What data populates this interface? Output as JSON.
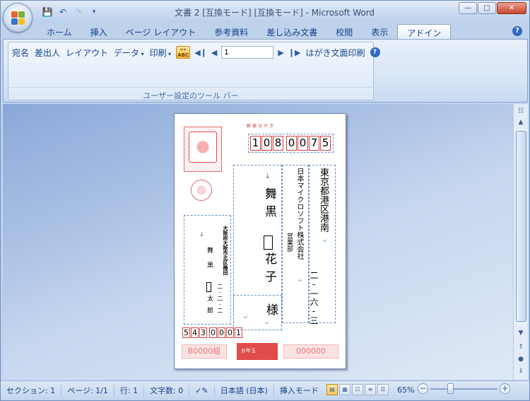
{
  "window": {
    "title": "文書 2 [互換モード] [互換モード] - Microsoft Word"
  },
  "qat": {
    "icons": [
      "save-icon",
      "undo-icon",
      "redo-icon",
      "qat-menu-icon"
    ]
  },
  "tabs": [
    {
      "label": "ホーム"
    },
    {
      "label": "挿入"
    },
    {
      "label": "ページ レイアウト"
    },
    {
      "label": "参考資料"
    },
    {
      "label": "差し込み文書"
    },
    {
      "label": "校閲"
    },
    {
      "label": "表示"
    },
    {
      "label": "アドイン",
      "active": true
    }
  ],
  "toolbar": {
    "addressee": "宛名",
    "sender": "差出人",
    "layout": "レイアウト",
    "data": "データ",
    "print": "印刷",
    "abc_label": "ABC",
    "page_value": "1",
    "print_front": "はがき文面印刷",
    "group_label": "ユーザー設定のツール バー"
  },
  "postcard": {
    "postal_label": "郵便はがき",
    "recipient_zip": [
      "1",
      "0",
      "8",
      "0",
      "0",
      "7",
      "5"
    ],
    "recipient_address": "東京都港区港南",
    "recipient_block": "二-一六-三",
    "recipient_company": "日本マイクロソフト株式会社",
    "recipient_dept": "営業部",
    "recipient_last": "舞黒",
    "recipient_first": "花子",
    "honorific": "様",
    "sender_address": "大阪府大阪市北区梅田",
    "sender_block": "二-二-二",
    "sender_last": "舞黒",
    "sender_first": "太郎",
    "sender_zip": [
      "5",
      "4",
      "3",
      "0",
      "0",
      "0",
      "1"
    ],
    "bottom_left": "B0000組",
    "bottom_right": "000000",
    "bottom_mid": "お年玉"
  },
  "statusbar": {
    "section": "セクション: 1",
    "page": "ページ: 1/1",
    "line": "行: 1",
    "chars": "文字数: 0",
    "language": "日本語 (日本)",
    "mode": "挿入モード",
    "zoom": "65%"
  },
  "colors": {
    "accent": "#15428b",
    "stamp_red": "#d04040"
  }
}
